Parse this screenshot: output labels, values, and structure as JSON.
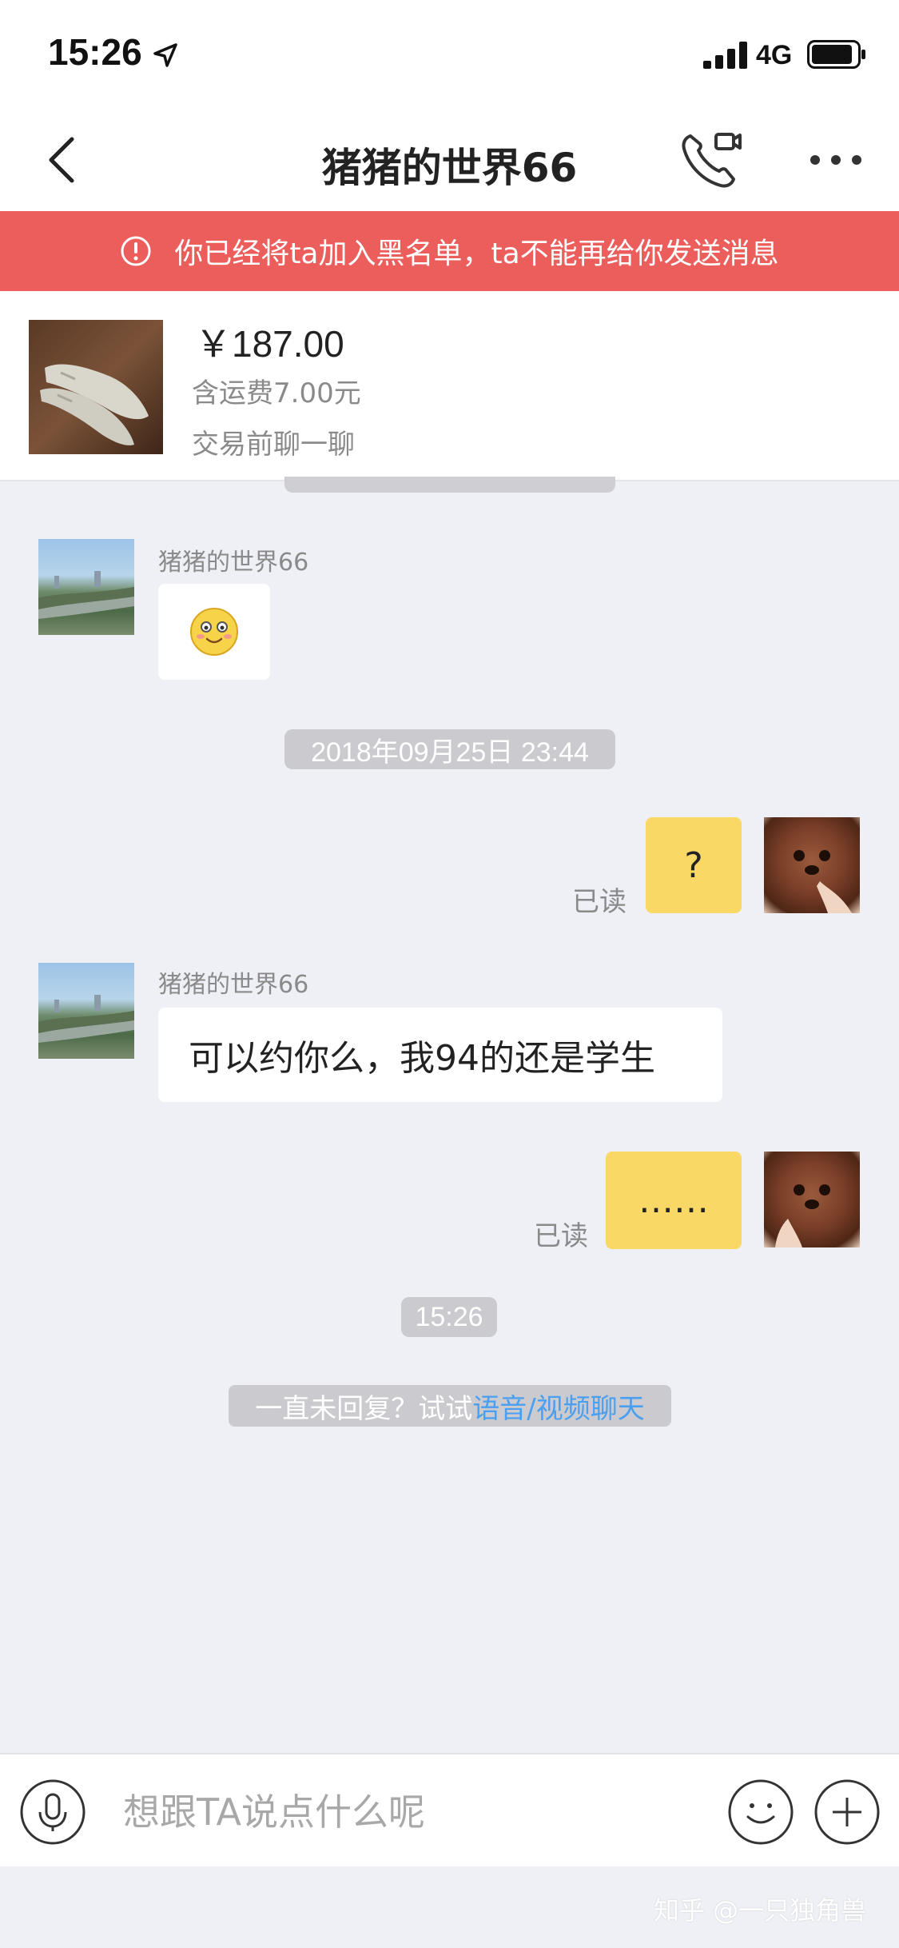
{
  "status_bar": {
    "time": "15:26",
    "network": "4G",
    "icons": [
      "location-arrow-icon",
      "signal-icon",
      "battery-icon"
    ]
  },
  "nav": {
    "title": "猪猪的世界66",
    "icons": [
      "back-icon",
      "video-call-icon",
      "more-icon"
    ]
  },
  "banner": {
    "text": "你已经将ta加入黑名单，ta不能再给你发送消息",
    "icon": "info-icon"
  },
  "product": {
    "price": "￥187.00",
    "shipping": "含运费7.00元",
    "subtitle": "交易前聊一聊"
  },
  "messages": {
    "contact_name": "猪猪的世界66",
    "incoming_1": {
      "sender": "猪猪的世界66",
      "content": "smiling-face-emoji"
    },
    "timestamp_1": "2018年09月25日 23:44",
    "outgoing_1": {
      "text": "?",
      "status": "已读"
    },
    "incoming_2": {
      "sender": "猪猪的世界66",
      "text": "可以约你么，我94的还是学生"
    },
    "outgoing_2": {
      "text": "……",
      "status": "已读"
    },
    "timestamp_2": "15:26",
    "hint": {
      "text": "一直未回复？试试",
      "link": "语音/视频聊天"
    }
  },
  "input_bar": {
    "placeholder": "想跟TA说点什么呢",
    "icons": [
      "microphone-icon",
      "emoji-icon",
      "plus-icon"
    ]
  },
  "watermark": "知乎 @一只独角兽",
  "colors": {
    "banner": "#ec5e5b",
    "outgoing_bubble": "#f9d865",
    "background": "#eff0f5",
    "link": "#4a9ff0"
  }
}
